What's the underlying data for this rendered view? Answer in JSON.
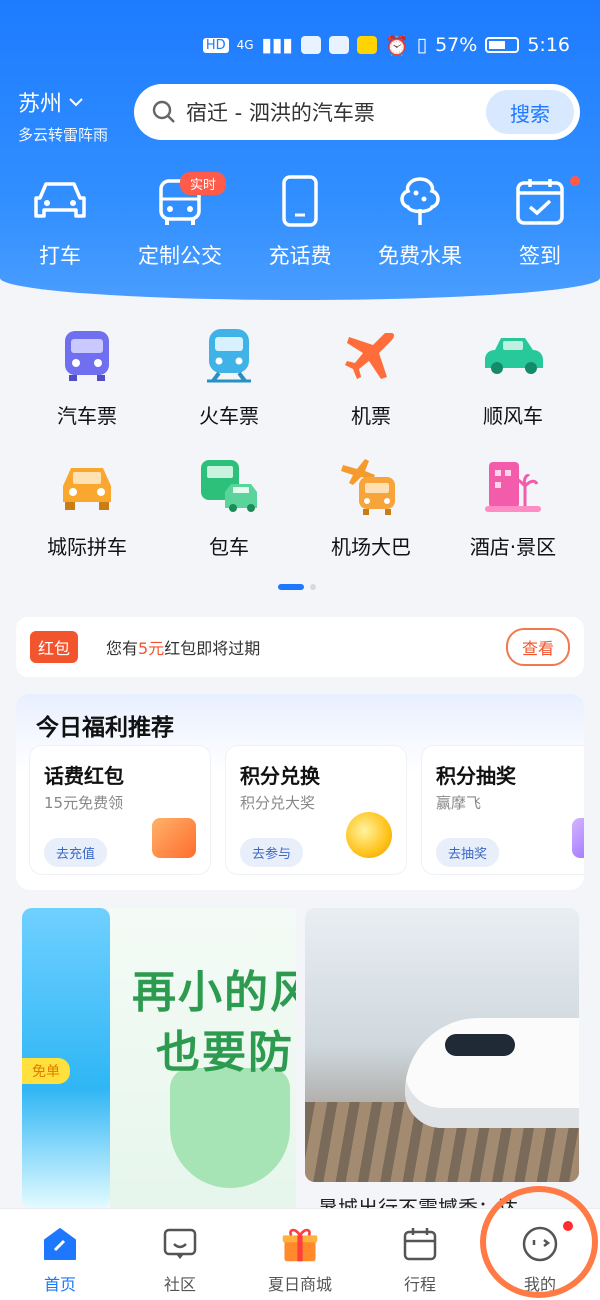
{
  "status_bar": {
    "battery": "57%",
    "time": "5:16",
    "network": "4G"
  },
  "header": {
    "city": "苏州",
    "weather": "多云转雷阵雨",
    "search_placeholder": "宿迁 - 泗洪的汽车票",
    "search_button": "搜索"
  },
  "quick_actions": [
    {
      "label": "打车",
      "icon": "car-icon"
    },
    {
      "label": "定制公交",
      "icon": "bus-icon",
      "badge": "实时"
    },
    {
      "label": "充话费",
      "icon": "phone-icon"
    },
    {
      "label": "免费水果",
      "icon": "tree-icon"
    },
    {
      "label": "签到",
      "icon": "calendar-check-icon"
    }
  ],
  "services": [
    {
      "label": "汽车票",
      "icon": "bus-icon",
      "color": "#6f6ff0"
    },
    {
      "label": "火车票",
      "icon": "train-icon",
      "color": "#3fb3e8"
    },
    {
      "label": "机票",
      "icon": "plane-icon",
      "color": "#ff6e3a"
    },
    {
      "label": "顺风车",
      "icon": "car-icon",
      "color": "#27c99a"
    },
    {
      "label": "城际拼车",
      "icon": "car-icon",
      "color": "#f9a72f"
    },
    {
      "label": "包车",
      "icon": "van-icon",
      "color": "#2cc07a"
    },
    {
      "label": "机场大巴",
      "icon": "airport-bus-icon",
      "color": "#f59b2d"
    },
    {
      "label": "酒店·景区",
      "icon": "hotel-icon",
      "color": "#f25cab"
    }
  ],
  "red_packet": {
    "tag": "红包",
    "msg_prefix": "您有",
    "amount": "5元",
    "msg_suffix": "红包即将过期",
    "button": "查看"
  },
  "welfare": {
    "title": "今日福利推荐",
    "cards": [
      {
        "title": "话费红包",
        "sub": "15元免费领",
        "action": "去充值",
        "color": "#ff8b3d"
      },
      {
        "title": "积分兑换",
        "sub": "积分兑大奖",
        "action": "去参与",
        "color": "#ffc21a"
      },
      {
        "title": "积分抽奖",
        "sub": "赢摩飞",
        "action": "去抽奖",
        "color": "#b383ff"
      }
    ]
  },
  "banners": {
    "left_tag": "免单",
    "center_line1": "再小的风",
    "center_line2": "也要防",
    "right_caption": "暑城出行不震撼季：达"
  },
  "tabbar": [
    {
      "label": "首页",
      "icon": "home-icon",
      "active": true
    },
    {
      "label": "社区",
      "icon": "chat-icon",
      "active": false
    },
    {
      "label": "夏日商城",
      "icon": "gift-icon",
      "active": false
    },
    {
      "label": "行程",
      "icon": "calendar-icon",
      "active": false
    },
    {
      "label": "我的",
      "icon": "profile-icon",
      "active": false
    }
  ]
}
